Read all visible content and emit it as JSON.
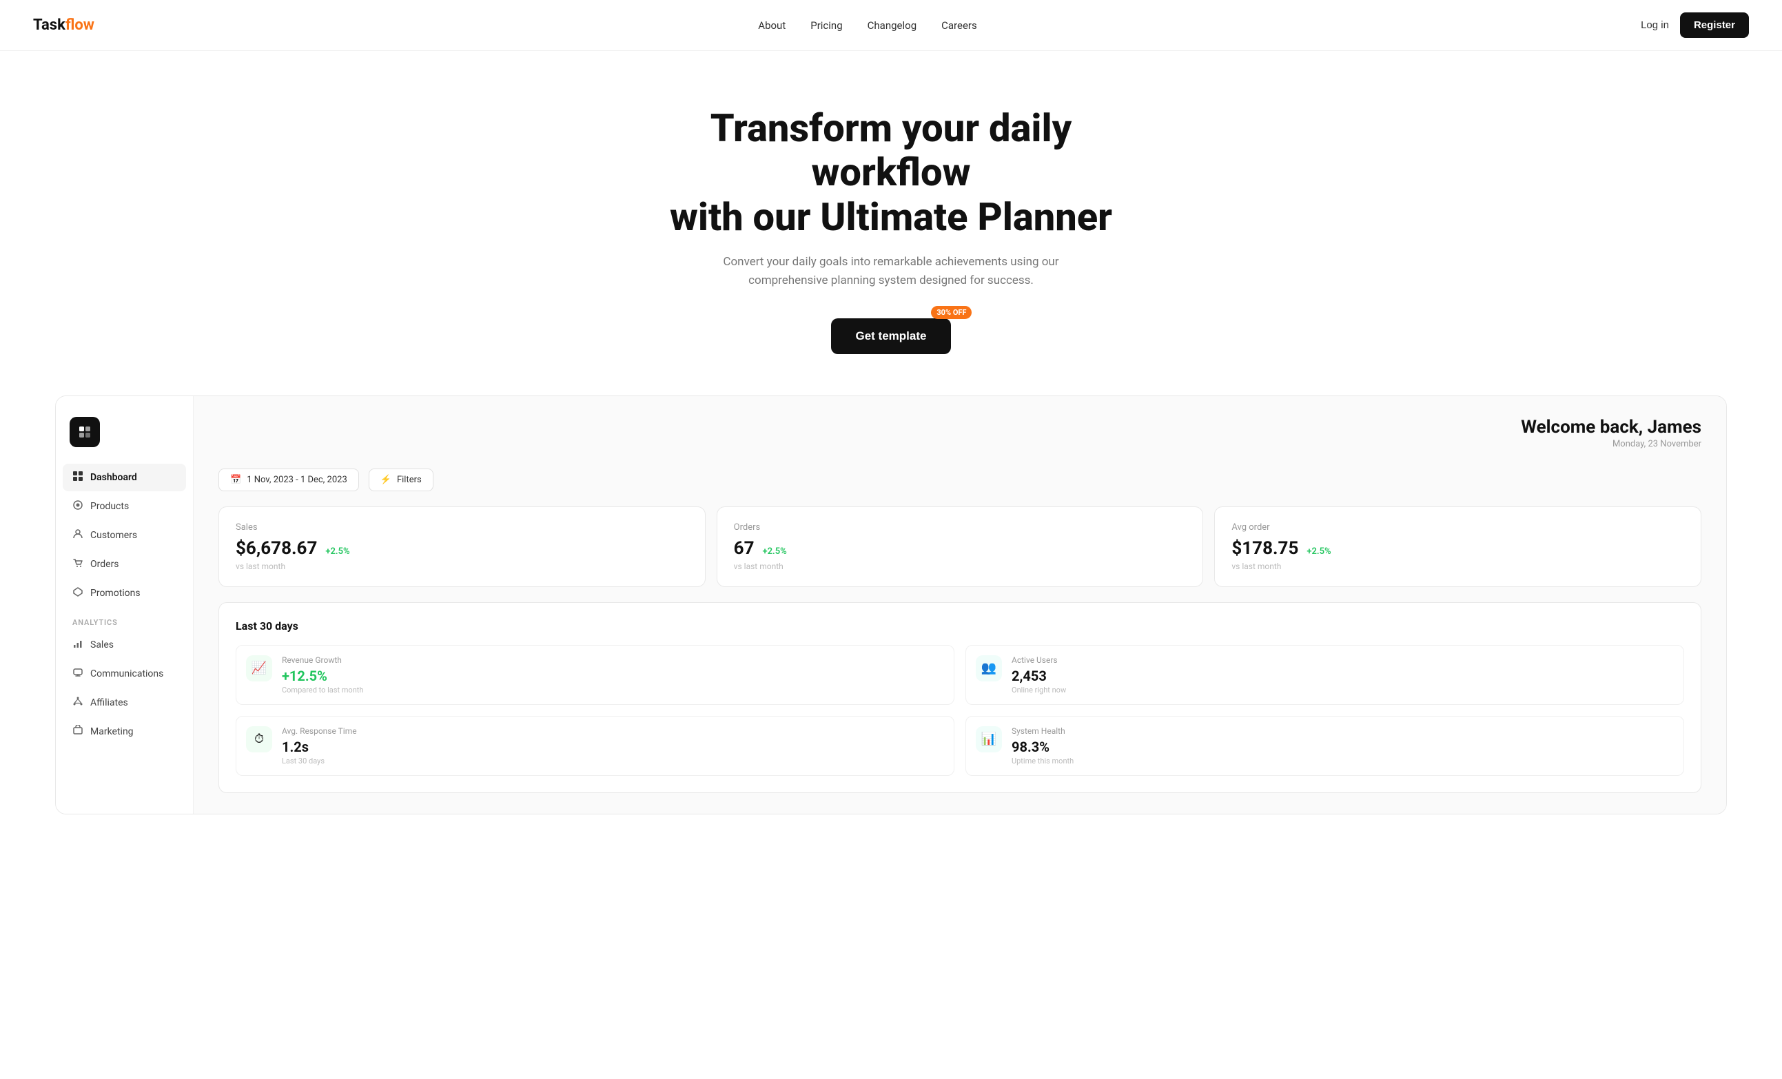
{
  "navbar": {
    "logo_text": "Task",
    "logo_accent": "flow",
    "links": [
      {
        "label": "About",
        "id": "about"
      },
      {
        "label": "Pricing",
        "id": "pricing"
      },
      {
        "label": "Changelog",
        "id": "changelog"
      },
      {
        "label": "Careers",
        "id": "careers"
      }
    ],
    "login_label": "Log in",
    "register_label": "Register"
  },
  "hero": {
    "headline_line1": "Transform your daily workflow",
    "headline_line2": "with our Ultimate Planner",
    "subtext": "Convert your daily goals into remarkable achievements using our comprehensive planning system designed for success.",
    "cta_label": "Get template",
    "discount_badge": "30% OFF"
  },
  "sidebar": {
    "logo_icon": "⬡",
    "nav_items": [
      {
        "label": "Dashboard",
        "icon": "⌂",
        "active": true,
        "id": "dashboard"
      },
      {
        "label": "Products",
        "icon": "◎",
        "active": false,
        "id": "products"
      },
      {
        "label": "Customers",
        "icon": "◉",
        "active": false,
        "id": "customers"
      },
      {
        "label": "Orders",
        "icon": "☍",
        "active": false,
        "id": "orders"
      },
      {
        "label": "Promotions",
        "icon": "⬟",
        "active": false,
        "id": "promotions"
      }
    ],
    "analytics_label": "Analytics",
    "analytics_items": [
      {
        "label": "Sales",
        "icon": "▦",
        "id": "sales"
      },
      {
        "label": "Communications",
        "icon": "◻",
        "id": "communications"
      },
      {
        "label": "Affiliates",
        "icon": "⋈",
        "id": "affiliates"
      },
      {
        "label": "Marketing",
        "icon": "✉",
        "id": "marketing"
      }
    ]
  },
  "dashboard": {
    "welcome_title": "Welcome back, James",
    "welcome_date": "Monday, 23 November",
    "date_range": "1 Nov, 2023 - 1 Dec, 2023",
    "filters_label": "Filters",
    "stats": [
      {
        "label": "Sales",
        "value": "$6,678.67",
        "change": "+2.5%",
        "vs": "vs last month"
      },
      {
        "label": "Orders",
        "value": "67",
        "change": "+2.5%",
        "vs": "vs last month"
      },
      {
        "label": "Avg order",
        "value": "$178.75",
        "change": "+2.5%",
        "vs": "vs last month"
      }
    ],
    "thirty_days_title": "Last 30 days",
    "metrics": [
      {
        "title": "Revenue Growth",
        "value": "+12.5%",
        "sub": "Compared to last month",
        "icon": "📈",
        "color": "green",
        "id": "revenue-growth"
      },
      {
        "title": "Active Users",
        "value": "2,453",
        "sub": "Online right now",
        "icon": "👥",
        "color": "teal",
        "id": "active-users"
      },
      {
        "title": "Avg. Response Time",
        "value": "1.2s",
        "sub": "Last 30 days",
        "icon": "⏱",
        "color": "green",
        "id": "avg-response-time"
      },
      {
        "title": "System Health",
        "value": "98.3%",
        "sub": "Uptime this month",
        "icon": "📊",
        "color": "teal",
        "id": "system-health"
      }
    ]
  }
}
